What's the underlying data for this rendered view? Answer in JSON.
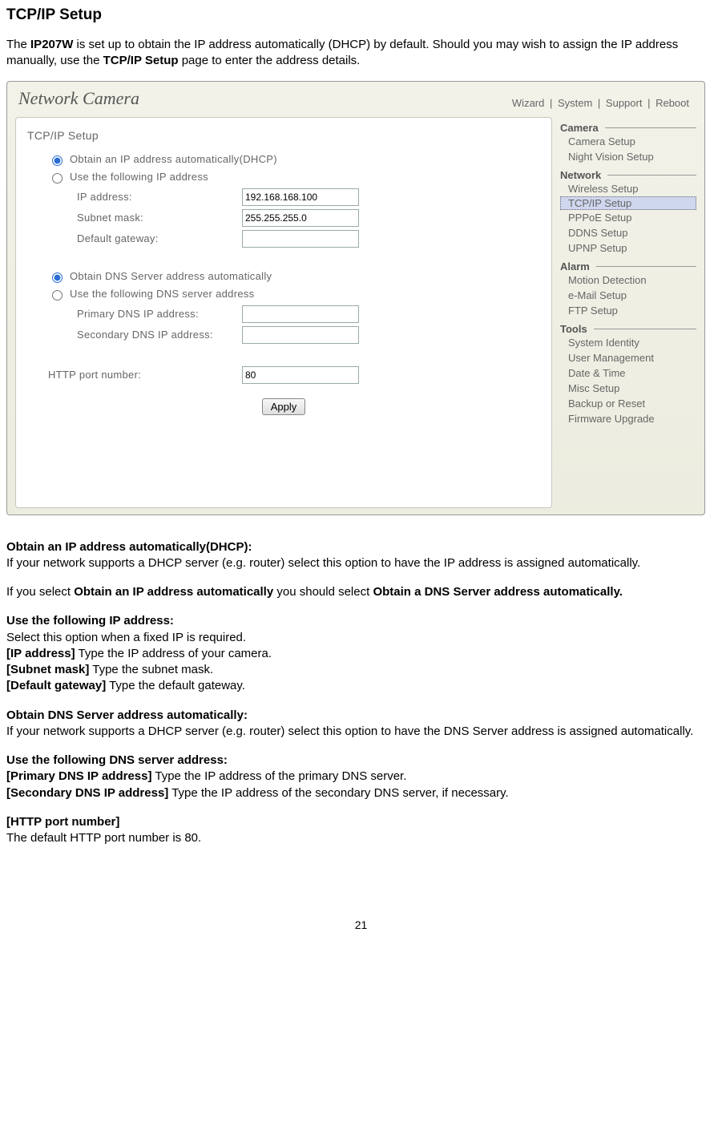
{
  "heading": "TCP/IP Setup",
  "intro": {
    "t1": "The ",
    "model": "IP207W",
    "t2": " is set up to obtain the IP address automatically (DHCP) by default. Should you may wish to assign the IP address manually, use the ",
    "page_name": "TCP/IP Setup",
    "t3": " page to enter the address details."
  },
  "screenshot": {
    "brand": "Network Camera",
    "topnav": {
      "wizard": "Wizard",
      "system": "System",
      "support": "Support",
      "reboot": "Reboot"
    },
    "form": {
      "title": "TCP/IP Setup",
      "radio_dhcp": "Obtain an IP address automatically(DHCP)",
      "radio_static": "Use the following IP address",
      "ip_label": "IP address:",
      "ip_value": "192.168.168.100",
      "mask_label": "Subnet mask:",
      "mask_value": "255.255.255.0",
      "gw_label": "Default gateway:",
      "gw_value": "",
      "radio_dns_auto": "Obtain DNS Server address automatically",
      "radio_dns_manual": "Use the following DNS server address",
      "pdns_label": "Primary DNS IP address:",
      "pdns_value": "",
      "sdns_label": "Secondary DNS IP address:",
      "sdns_value": "",
      "http_label": "HTTP port number:",
      "http_value": "80",
      "apply": "Apply"
    },
    "sidebar": {
      "camera_h": "Camera",
      "camera": [
        "Camera Setup",
        "Night Vision Setup"
      ],
      "network_h": "Network",
      "network": [
        "Wireless Setup",
        "TCP/IP Setup",
        "PPPoE Setup",
        "DDNS Setup",
        "UPNP Setup"
      ],
      "network_selected_idx": 1,
      "alarm_h": "Alarm",
      "alarm": [
        "Motion Detection",
        "e-Mail Setup",
        "FTP Setup"
      ],
      "tools_h": "Tools",
      "tools": [
        "System Identity",
        "User Management",
        "Date & Time",
        "Misc Setup",
        "Backup or Reset",
        "Firmware Upgrade"
      ]
    }
  },
  "explain": {
    "s1_h": "Obtain an IP address automatically(DHCP):",
    "s1_b": "If your network supports a DHCP server (e.g. router) select this option to have the IP address is assigned automatically.",
    "s1b_t1": "If you select ",
    "s1b_b1": "Obtain an IP address automatically",
    "s1b_t2": " you should select ",
    "s1b_b2": "Obtain a DNS Server address automatically.",
    "s2_h": "Use the following IP address:",
    "s2_b": "Select this option when a fixed IP is required.",
    "s2_ip_h": "[IP address]",
    "s2_ip_b": " Type the IP address of your camera.",
    "s2_mask_h": "[Subnet mask]",
    "s2_mask_b": " Type the subnet mask.",
    "s2_gw_h": "[Default gateway]",
    "s2_gw_b": " Type the default gateway.",
    "s3_h": "Obtain DNS Server address automatically:",
    "s3_b": "If your network supports a DHCP server (e.g. router) select this option to have the DNS Server address is assigned automatically.",
    "s4_h": "Use the following DNS server address:",
    "s4_p_h": "[Primary DNS IP address]",
    "s4_p_b": " Type the IP address of the primary DNS server.",
    "s4_s_h": "[Secondary DNS IP address]",
    "s4_s_b": " Type the IP address of the secondary DNS server, if necessary.",
    "s5_h": "[HTTP port number]",
    "s5_b": "The default HTTP port number is 80."
  },
  "page_number": "21"
}
